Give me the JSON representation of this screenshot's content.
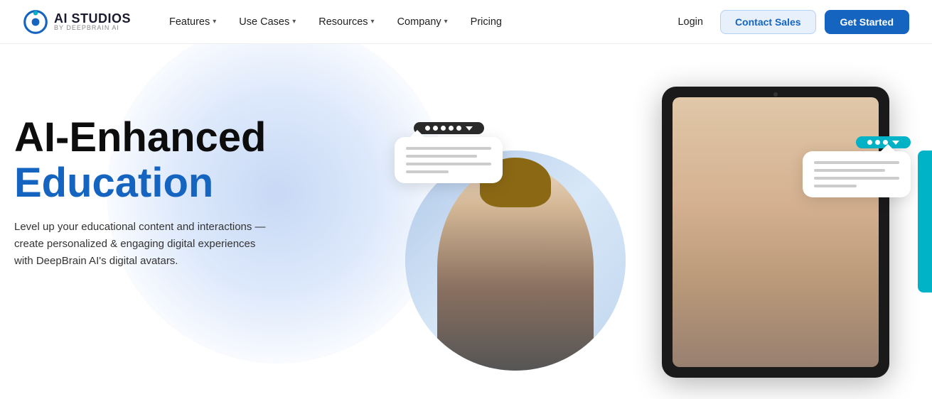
{
  "brand": {
    "logo_alt": "AI Studios by DeepBrain AI",
    "logo_main": "AI STUDIOS",
    "logo_sub": "by DEEPBRAIN AI"
  },
  "navbar": {
    "items": [
      {
        "label": "Features",
        "has_dropdown": true
      },
      {
        "label": "Use Cases",
        "has_dropdown": true
      },
      {
        "label": "Resources",
        "has_dropdown": true
      },
      {
        "label": "Company",
        "has_dropdown": true
      },
      {
        "label": "Pricing",
        "has_dropdown": false
      }
    ],
    "login_label": "Login",
    "contact_sales_label": "Contact Sales",
    "get_started_label": "Get Started"
  },
  "hero": {
    "title_line1": "AI-Enhanced",
    "title_line2": "Education",
    "description": "Level up your educational content and interactions — create personalized & engaging digital experiences with DeepBrain AI's digital avatars.",
    "chat_handle_left": "⊕ ⊕ ⊕ ⊕ ⊕",
    "chat_handle_right": "⊕ ⊕ ⊕"
  }
}
